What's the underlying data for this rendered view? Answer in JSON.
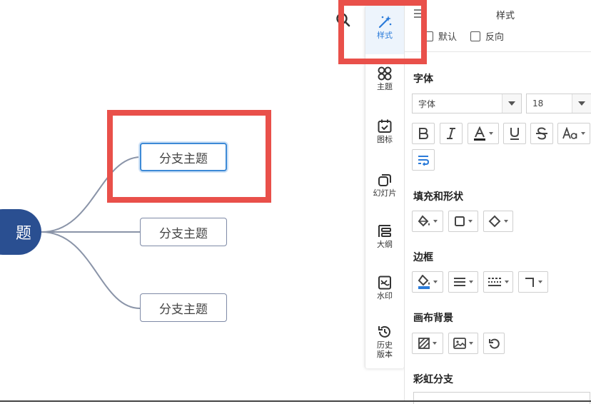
{
  "canvas": {
    "root_label": "题",
    "branches": [
      "分支主题",
      "分支主题",
      "分支主题"
    ]
  },
  "toolbar": {
    "items": [
      {
        "label": "样式",
        "icon": "magic-wand-icon",
        "active": true
      },
      {
        "label": "主题",
        "icon": "theme-icon"
      },
      {
        "label": "图标",
        "icon": "calendar-check-icon"
      },
      {
        "label": "幻灯片",
        "icon": "slides-icon"
      },
      {
        "label": "大纲",
        "icon": "outline-icon"
      },
      {
        "label": "水印",
        "icon": "watermark-icon"
      },
      {
        "label": "历史\n版本",
        "icon": "history-icon"
      }
    ]
  },
  "panel": {
    "title": "样式",
    "default_label": "默认",
    "reverse_label": "反向",
    "font_section": "字体",
    "font_family": "字体",
    "font_size": "18",
    "fill_section": "填充和形状",
    "border_section": "边框",
    "canvas_bg_section": "画布背景",
    "rainbow_section": "彩虹分支"
  },
  "colors": {
    "accent": "#2b7bd9",
    "root_fill": "#2a4f91",
    "highlight": "#e9504a",
    "branch_border": "#7e8aa6"
  }
}
